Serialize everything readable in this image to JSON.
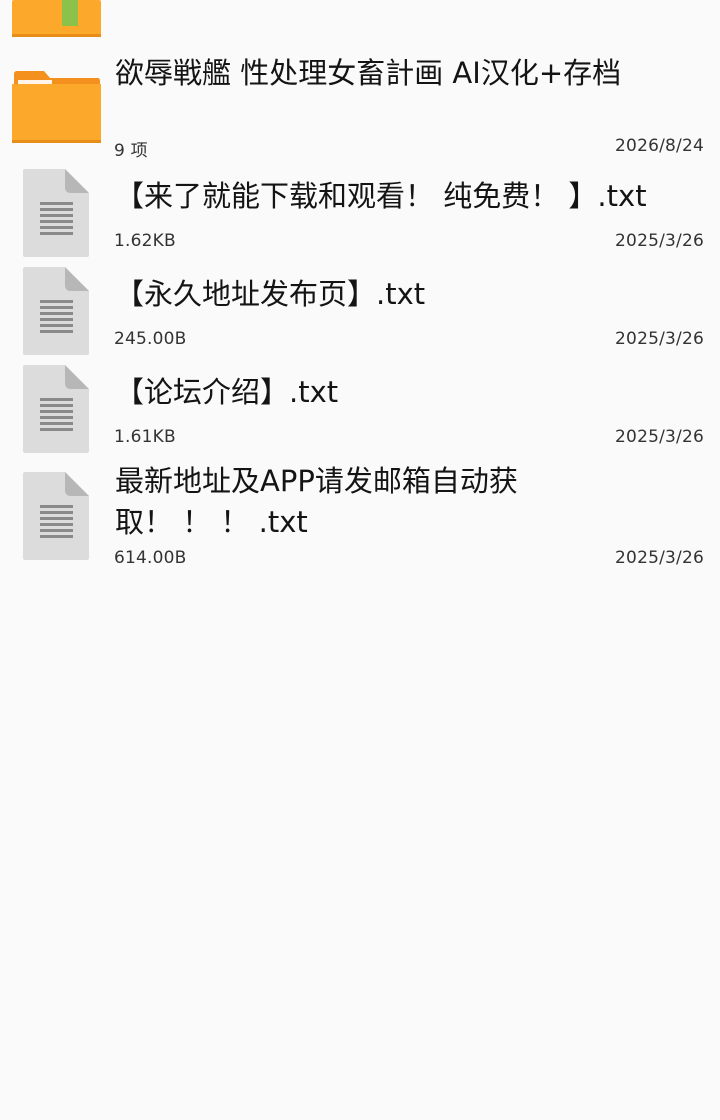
{
  "items": [
    {
      "type": "folder",
      "icon": "folder-plus-icon",
      "name": "",
      "meta": "",
      "date": ""
    },
    {
      "type": "folder",
      "icon": "folder-icon",
      "name": "欲辱戦艦 性处理女畜計画 AI汉化+存档",
      "meta": "9 项",
      "date": "2026/8/24"
    },
    {
      "type": "file",
      "icon": "text-file-icon",
      "name": "【来了就能下载和观看！ 纯免费！ 】.txt",
      "meta": "1.62KB",
      "date": "2025/3/26"
    },
    {
      "type": "file",
      "icon": "text-file-icon",
      "name": "【永久地址发布页】.txt",
      "meta": "245.00B",
      "date": "2025/3/26"
    },
    {
      "type": "file",
      "icon": "text-file-icon",
      "name": "【论坛介绍】.txt",
      "meta": "1.61KB",
      "date": "2025/3/26"
    },
    {
      "type": "file",
      "icon": "text-file-icon",
      "name": "最新地址及APP请发邮箱自动获取！ ！ ！ .txt",
      "meta": "614.00B",
      "date": "2025/3/26"
    }
  ],
  "colors": {
    "folder_body": "#fba82b",
    "folder_tab": "#f4911e",
    "folder_plus": "#8bc34a",
    "file_page": "#dcdcdc",
    "file_fold": "#b7b7b7",
    "file_lines": "#8a8a8a",
    "background": "#fafafa"
  }
}
